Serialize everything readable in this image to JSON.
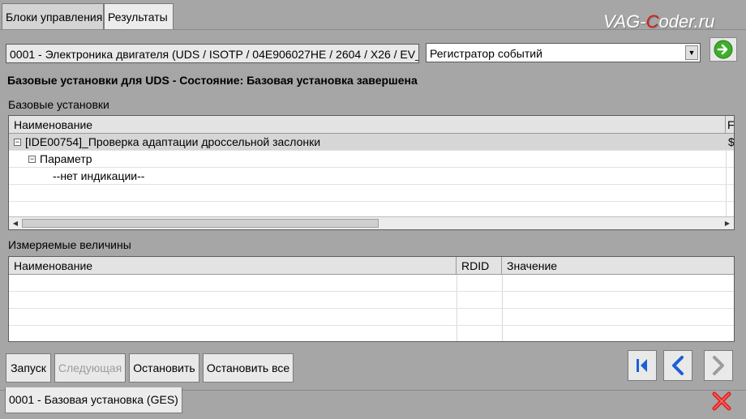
{
  "tabs": [
    {
      "label": "Блоки управления",
      "active": false
    },
    {
      "label": "Результаты",
      "active": true
    }
  ],
  "watermark": {
    "part1": "VAG-",
    "part2": "C",
    "part3": "oder.ru"
  },
  "module_field": {
    "value": "0001 - Электроника двигателя  (UDS / ISOTP / 04E906027HE / 2604 / X26 / EV_"
  },
  "event_select": {
    "value": "Регистратор событий"
  },
  "status_heading": "Базовые установки для UDS - Состояние: Базовая установка завершена",
  "basic_settings": {
    "label": "Базовые установки",
    "columns": [
      "Наименование",
      "F"
    ],
    "rows": [
      {
        "text": "[IDE00754]_Проверка адаптации дроссельной заслонки",
        "level": 0,
        "expandable": true,
        "selected": true,
        "extra": "$"
      },
      {
        "text": "Параметр",
        "level": 1,
        "expandable": true,
        "selected": false,
        "extra": ""
      },
      {
        "text": "--нет индикации--",
        "level": 2,
        "expandable": false,
        "selected": false,
        "extra": ""
      }
    ]
  },
  "measured_values": {
    "label": "Измеряемые величины",
    "columns": [
      "Наименование",
      "RDID",
      "Значение"
    ]
  },
  "buttons": {
    "start": "Запуск",
    "next": "Следующая",
    "stop": "Остановить",
    "stop_all": "Остановить все"
  },
  "bottom_tab": "0001 - Базовая установка (GES)",
  "colors": {
    "go_green": "#3fae2a",
    "nav_blue": "#1a5fd6",
    "close_red": "#e02020"
  }
}
